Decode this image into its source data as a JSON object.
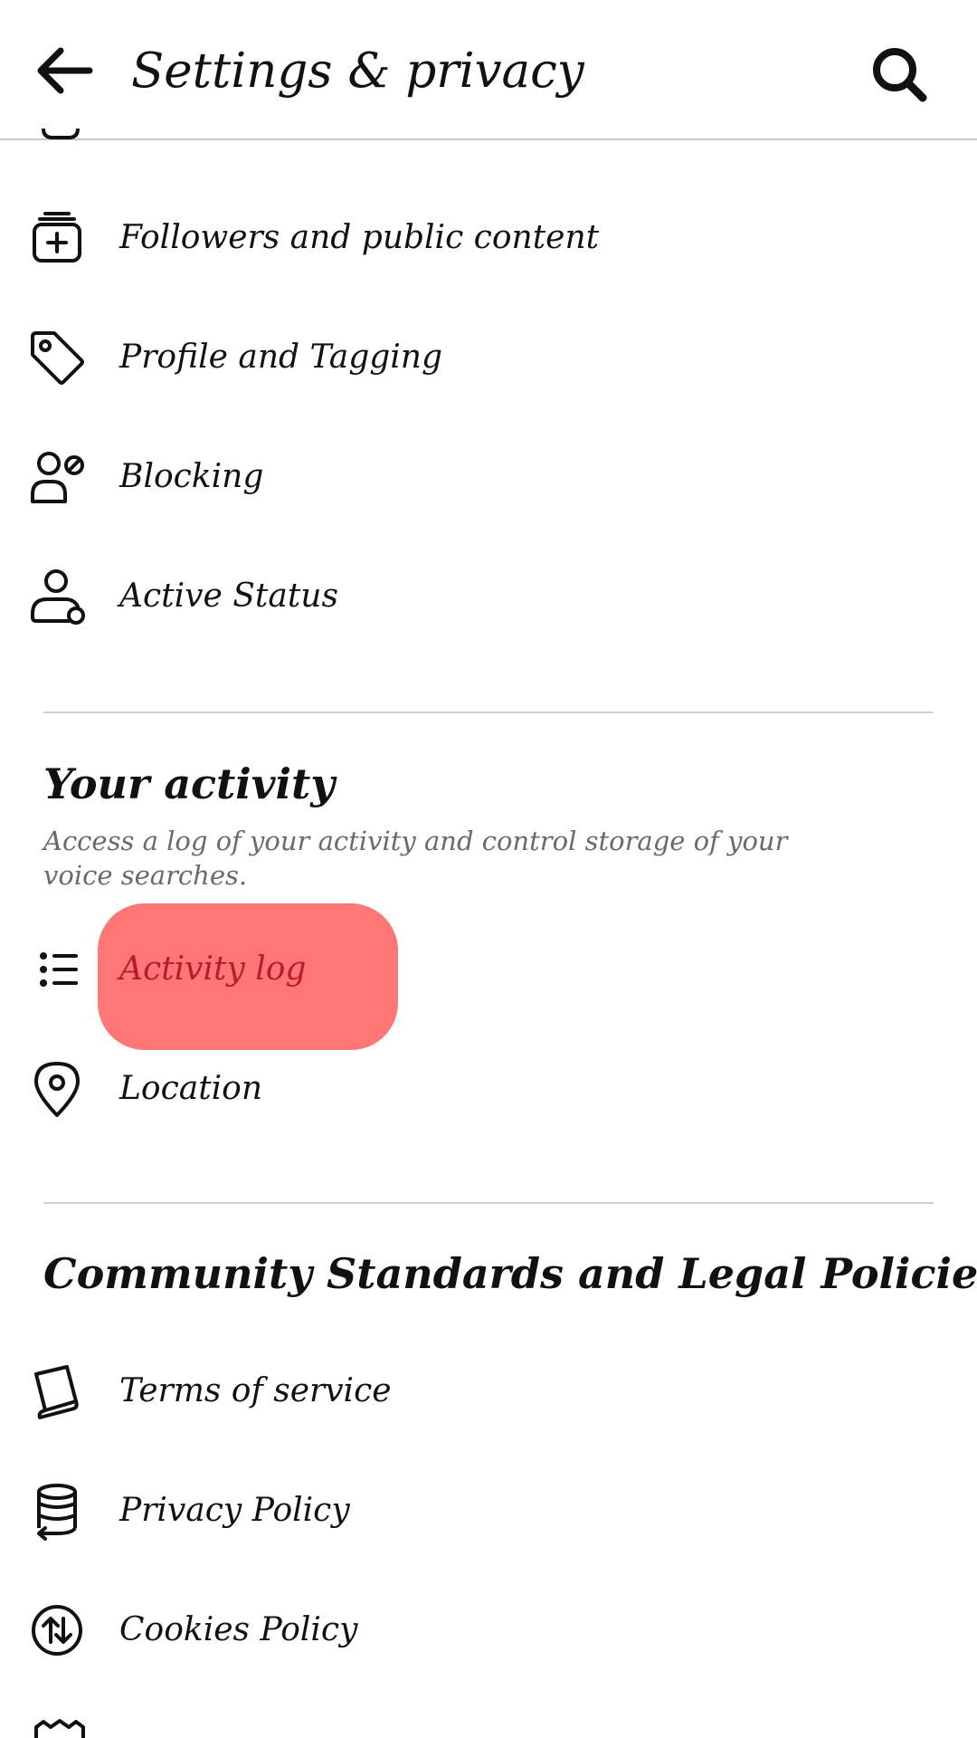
{
  "header": {
    "title": "Settings & privacy",
    "back_icon": "arrow-left-icon",
    "search_icon": "search-icon"
  },
  "privacy_items": [
    {
      "label": "Followers and public content",
      "icon": "followers-add-icon"
    },
    {
      "label": "Profile and Tagging",
      "icon": "tag-icon"
    },
    {
      "label": "Blocking",
      "icon": "user-block-icon"
    },
    {
      "label": "Active Status",
      "icon": "user-status-icon"
    }
  ],
  "your_activity": {
    "title": "Your activity",
    "subtitle": "Access a log of your activity and control storage of your voice searches.",
    "items": [
      {
        "label": "Activity log",
        "icon": "list-icon"
      },
      {
        "label": "Location",
        "icon": "location-pin-icon"
      }
    ]
  },
  "community": {
    "title": "Community Standards and Legal Policies",
    "items": [
      {
        "label": "Terms of service",
        "icon": "book-icon"
      },
      {
        "label": "Privacy Policy",
        "icon": "database-icon"
      },
      {
        "label": "Cookies Policy",
        "icon": "cookies-arrows-icon"
      }
    ]
  },
  "colors": {
    "highlight": "#ff7676",
    "highlight_text": "#b81c2c",
    "subtitle_text": "#6a6a6a",
    "divider": "#cfcfcf"
  }
}
